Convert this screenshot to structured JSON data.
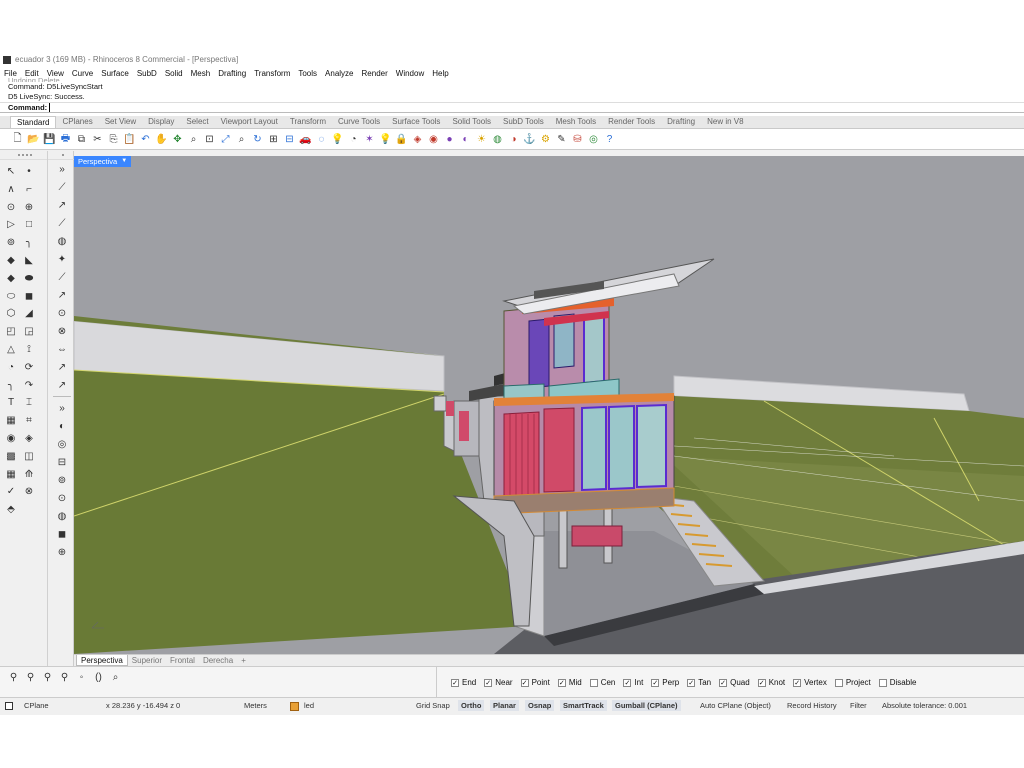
{
  "window": {
    "title": "ecuador 3 (169 MB) - Rhinoceros 8 Commercial - [Perspectiva]"
  },
  "menu": [
    "File",
    "Edit",
    "View",
    "Curve",
    "Surface",
    "SubD",
    "Solid",
    "Mesh",
    "Drafting",
    "Transform",
    "Tools",
    "Analyze",
    "Render",
    "Window",
    "Help"
  ],
  "command": {
    "history": [
      "Undoing Delete",
      "Command: D5LiveSyncStart",
      "D5 LiveSync: Success."
    ],
    "prompt_label": "Command:",
    "value": ""
  },
  "toolbar_tabs": [
    "Standard",
    "CPlanes",
    "Set View",
    "Display",
    "Select",
    "Viewport Layout",
    "Transform",
    "Curve Tools",
    "Surface Tools",
    "Solid Tools",
    "SubD Tools",
    "Mesh Tools",
    "Render Tools",
    "Drafting",
    "New in V8"
  ],
  "active_toolbar_tab": "Standard",
  "standard_tools": [
    {
      "name": "new-icon",
      "glyph": "🗋"
    },
    {
      "name": "open-icon",
      "glyph": "📂"
    },
    {
      "name": "save-icon",
      "glyph": "💾"
    },
    {
      "name": "print-icon",
      "glyph": "🖶"
    },
    {
      "name": "import-icon",
      "glyph": "⧉"
    },
    {
      "name": "cut-icon",
      "glyph": "✂"
    },
    {
      "name": "copy-icon",
      "glyph": "⎘"
    },
    {
      "name": "paste-icon",
      "glyph": "📋"
    },
    {
      "name": "undo-icon",
      "glyph": "↶"
    },
    {
      "name": "pan-icon",
      "glyph": "✋"
    },
    {
      "name": "move-view-icon",
      "glyph": "✥"
    },
    {
      "name": "zoom-icon",
      "glyph": "⌕"
    },
    {
      "name": "zoom-window-icon",
      "glyph": "⊡"
    },
    {
      "name": "zoom-extents-icon",
      "glyph": "⤢"
    },
    {
      "name": "zoom-selected-icon",
      "glyph": "⌕"
    },
    {
      "name": "rotate-view-icon",
      "glyph": "↻"
    },
    {
      "name": "four-view-icon",
      "glyph": "⊞"
    },
    {
      "name": "cplane-icon",
      "glyph": "⊟"
    },
    {
      "name": "car-icon",
      "glyph": "🚗"
    },
    {
      "name": "select-icon",
      "glyph": "◌"
    },
    {
      "name": "show-icon",
      "glyph": "💡"
    },
    {
      "name": "hide-icon",
      "glyph": "◔"
    },
    {
      "name": "point-icon",
      "glyph": "✶"
    },
    {
      "name": "bulb-icon",
      "glyph": "💡"
    },
    {
      "name": "lock-icon",
      "glyph": "🔒"
    },
    {
      "name": "layer-icon",
      "glyph": "◈"
    },
    {
      "name": "color-wheel-icon",
      "glyph": "◉"
    },
    {
      "name": "material-icon",
      "glyph": "●"
    },
    {
      "name": "render-icon",
      "glyph": "◐"
    },
    {
      "name": "sun-icon",
      "glyph": "☀"
    },
    {
      "name": "environment-icon",
      "glyph": "◍"
    },
    {
      "name": "snapshot-icon",
      "glyph": "◑"
    },
    {
      "name": "grasshopper-icon",
      "glyph": "⚓"
    },
    {
      "name": "gear-icon",
      "glyph": "⚙"
    },
    {
      "name": "macro-icon",
      "glyph": "✎"
    },
    {
      "name": "texture-icon",
      "glyph": "⛁"
    },
    {
      "name": "globe-icon",
      "glyph": "◎"
    },
    {
      "name": "help-icon",
      "glyph": "?"
    }
  ],
  "left_tools_col1": [
    "↖",
    "•",
    "∧",
    "⌐",
    "⊙",
    "⊕",
    "▷",
    "□",
    "⊚",
    "╮",
    "◆",
    "◣",
    "◆",
    "⬬",
    "⬭",
    "◼",
    "⬡",
    "◢",
    "◰",
    "◲",
    "△",
    "⟟",
    "◔",
    "⟳",
    "╮",
    "↷",
    "T",
    "⌶",
    "▦",
    "⌗",
    "◉",
    "◈",
    "▩",
    "◫",
    "▦",
    "⟰",
    "✓",
    "⊗",
    "⬘",
    ""
  ],
  "left_tools_col2": [
    "»",
    "⟋",
    "↗",
    "⟋",
    "◍",
    "✦",
    "⟋",
    "↗",
    "⊙",
    "⊗",
    "⇔",
    "↗",
    "↗",
    "»",
    "◐",
    "◎",
    "⊟",
    "⊚",
    "⊙",
    "◍",
    "◼",
    "⊕"
  ],
  "viewport": {
    "name": "Perspectiva"
  },
  "viewport_tabs": [
    "Perspectiva",
    "Superior",
    "Frontal",
    "Derecha"
  ],
  "active_viewport_tab": "Perspectiva",
  "add_viewport_label": "+",
  "bottom_icons": [
    "⚲",
    "⚲",
    "⚲",
    "⚲",
    "◦",
    "()",
    "⌕"
  ],
  "osnaps": [
    {
      "label": "End",
      "checked": true
    },
    {
      "label": "Near",
      "checked": true
    },
    {
      "label": "Point",
      "checked": true
    },
    {
      "label": "Mid",
      "checked": true
    },
    {
      "label": "Cen",
      "checked": false
    },
    {
      "label": "Int",
      "checked": true
    },
    {
      "label": "Perp",
      "checked": true
    },
    {
      "label": "Tan",
      "checked": true
    },
    {
      "label": "Quad",
      "checked": true
    },
    {
      "label": "Knot",
      "checked": true
    },
    {
      "label": "Vertex",
      "checked": true
    },
    {
      "label": "Project",
      "checked": false
    },
    {
      "label": "Disable",
      "checked": false
    }
  ],
  "status": {
    "cplane": "CPlane",
    "coords": "x 28.236   y -16.494   z 0",
    "units": "Meters",
    "layer": "led",
    "layer_color": "#e8a036",
    "grid_snap": "Grid Snap",
    "ortho": "Ortho",
    "planar": "Planar",
    "osnap": "Osnap",
    "smarttrack": "SmartTrack",
    "gumball": "Gumball (CPlane)",
    "auto_cplane": "Auto CPlane (Object)",
    "record_history": "Record History",
    "filter": "Filter",
    "tolerance": "Absolute tolerance: 0.001"
  },
  "colors": {
    "accent": "#3a86ff",
    "viewport_bg": "#9e9fa4",
    "terrain": "#6b7a3a"
  }
}
